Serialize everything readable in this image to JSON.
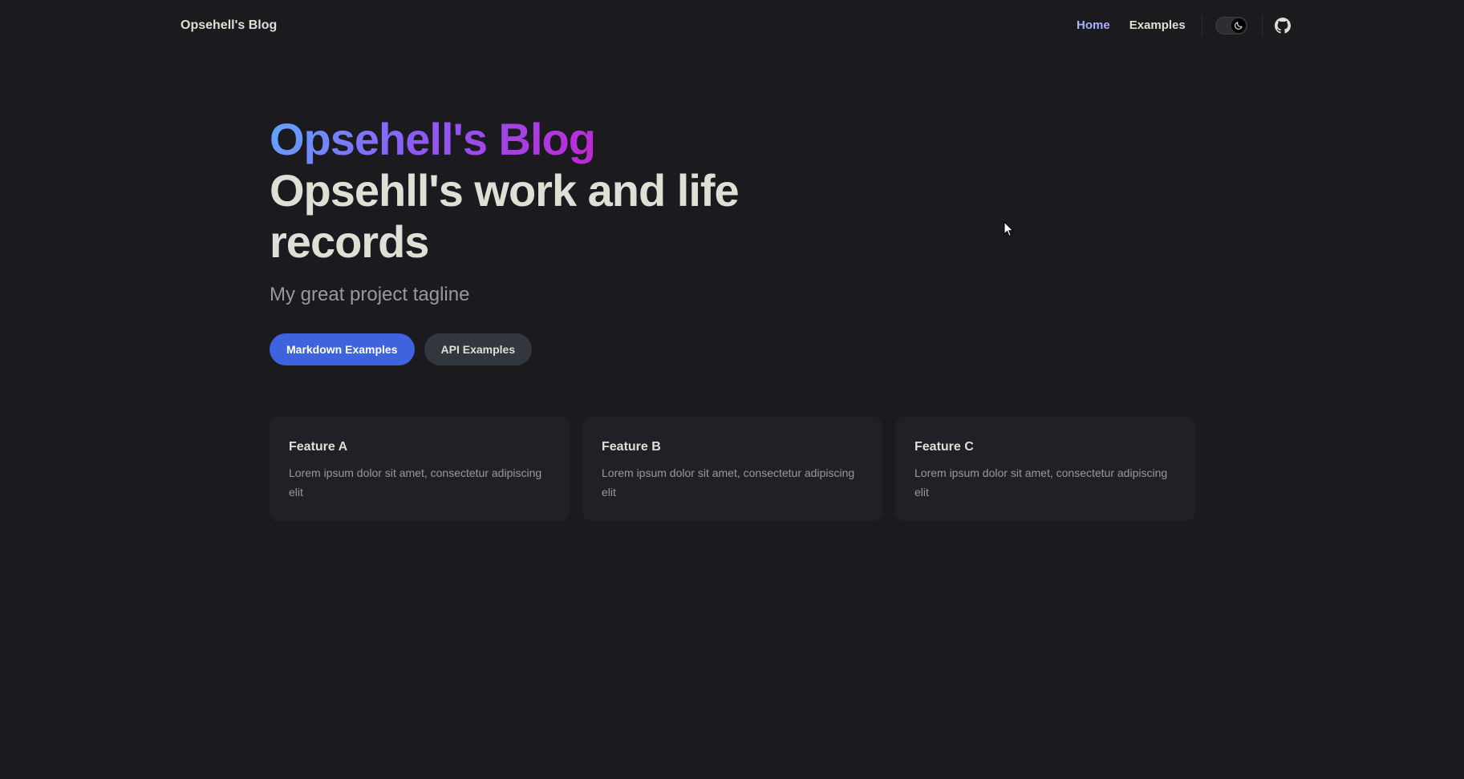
{
  "nav": {
    "site_title": "Opsehell's Blog",
    "links": [
      {
        "label": "Home",
        "active": true
      },
      {
        "label": "Examples",
        "active": false
      }
    ]
  },
  "hero": {
    "name": "Opsehell's Blog",
    "text": "Opsehll's work and life records",
    "tagline": "My great project tagline",
    "actions": [
      {
        "label": "Markdown Examples",
        "theme": "brand"
      },
      {
        "label": "API Examples",
        "theme": "alt"
      }
    ]
  },
  "features": [
    {
      "title": "Feature A",
      "details": "Lorem ipsum dolor sit amet, consectetur adipiscing elit"
    },
    {
      "title": "Feature B",
      "details": "Lorem ipsum dolor sit amet, consectetur adipiscing elit"
    },
    {
      "title": "Feature C",
      "details": "Lorem ipsum dolor sit amet, consectetur adipiscing elit"
    }
  ],
  "icons": {
    "theme_toggle": "moon-icon",
    "github": "github-icon"
  },
  "colors": {
    "background": "#1b1b1f",
    "brand": "#3e63dd",
    "active_link": "#a8b1ff",
    "card": "#202127"
  }
}
